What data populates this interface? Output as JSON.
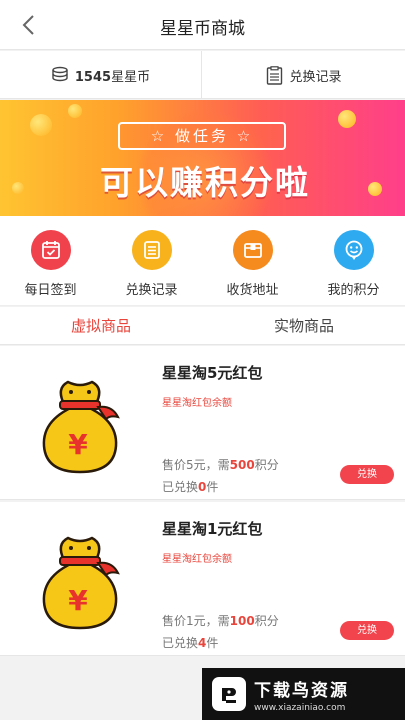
{
  "header": {
    "title": "星星币商城",
    "back_icon": "back-arrow-icon"
  },
  "balance": {
    "amount": "1545",
    "unit": "星星币",
    "records_label": "兑换记录"
  },
  "banner": {
    "tag": "☆ 做任务 ☆",
    "headline": "可以赚积分啦"
  },
  "quick_menu": [
    {
      "label": "每日签到",
      "icon": "calendar-icon",
      "color": "#f0424c"
    },
    {
      "label": "兑换记录",
      "icon": "list-icon",
      "color": "#f7b21c"
    },
    {
      "label": "收货地址",
      "icon": "box-icon",
      "color": "#f58a1f"
    },
    {
      "label": "我的积分",
      "icon": "smile-icon",
      "color": "#2eaaf0"
    }
  ],
  "tabs": [
    {
      "label": "虚拟商品",
      "active": true
    },
    {
      "label": "实物商品",
      "active": false
    }
  ],
  "products": [
    {
      "name": "星星淘5元红包",
      "desc": "星星淘红包余额",
      "price_prefix": "售价5元，需",
      "points": "500",
      "points_suffix": "积分",
      "sold_prefix": "已兑换",
      "sold_count": "0",
      "sold_suffix": "件",
      "button": "兑换"
    },
    {
      "name": "星星淘1元红包",
      "desc": "星星淘红包余额",
      "price_prefix": "售价1元，需",
      "points": "100",
      "points_suffix": "积分",
      "sold_prefix": "已兑换",
      "sold_count": "4",
      "sold_suffix": "件",
      "button": "兑换"
    }
  ],
  "watermark": {
    "name": "下载鸟资源",
    "url": "www.xiazainiao.com"
  }
}
